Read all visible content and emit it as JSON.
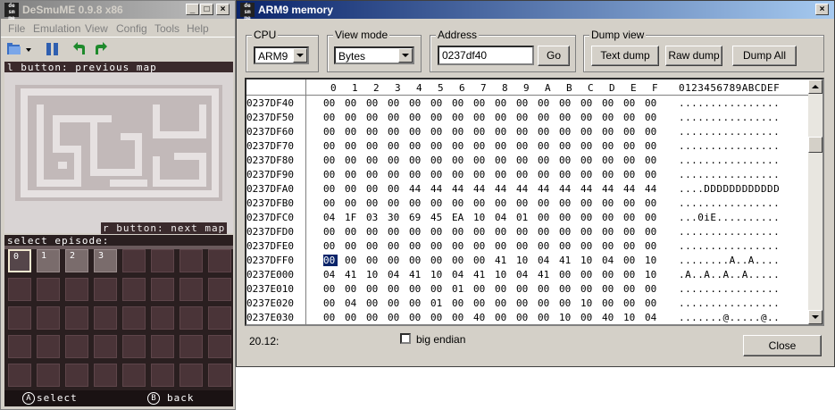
{
  "desmume": {
    "title": "DeSmuME 0.9.8 x86",
    "icon_text": "de sm me",
    "menu": [
      "File",
      "Emulation",
      "View",
      "Config",
      "Tools",
      "Help"
    ],
    "top_screen": {
      "hint_previous": "l button: previous map",
      "hint_next": "r button: next map"
    },
    "bottom_screen": {
      "header": "select episode:",
      "episodes": [
        "0",
        "1",
        "2",
        "3"
      ],
      "footer_select_key": "A",
      "footer_select": "select",
      "footer_back_key": "B",
      "footer_back": "back"
    }
  },
  "memory": {
    "title": "ARM9 memory",
    "icon_text": "de sm me",
    "cpu": {
      "label": "CPU",
      "value": "ARM9"
    },
    "view_mode": {
      "label": "View mode",
      "value": "Bytes"
    },
    "address": {
      "label": "Address",
      "value": "0237df40",
      "go": "Go"
    },
    "dump_view": {
      "label": "Dump view",
      "text_dump": "Text dump",
      "raw_dump": "Raw dump",
      "dump_all": "Dump All"
    },
    "header_cols": [
      "0",
      "1",
      "2",
      "3",
      "4",
      "5",
      "6",
      "7",
      "8",
      "9",
      "A",
      "B",
      "C",
      "D",
      "E",
      "F"
    ],
    "header_ascii": "0123456789ABCDEF",
    "rows": [
      {
        "addr": "0237DF40",
        "bytes": [
          "00",
          "00",
          "00",
          "00",
          "00",
          "00",
          "00",
          "00",
          "00",
          "00",
          "00",
          "00",
          "00",
          "00",
          "00",
          "00"
        ],
        "ascii": "................"
      },
      {
        "addr": "0237DF50",
        "bytes": [
          "00",
          "00",
          "00",
          "00",
          "00",
          "00",
          "00",
          "00",
          "00",
          "00",
          "00",
          "00",
          "00",
          "00",
          "00",
          "00"
        ],
        "ascii": "................"
      },
      {
        "addr": "0237DF60",
        "bytes": [
          "00",
          "00",
          "00",
          "00",
          "00",
          "00",
          "00",
          "00",
          "00",
          "00",
          "00",
          "00",
          "00",
          "00",
          "00",
          "00"
        ],
        "ascii": "................"
      },
      {
        "addr": "0237DF70",
        "bytes": [
          "00",
          "00",
          "00",
          "00",
          "00",
          "00",
          "00",
          "00",
          "00",
          "00",
          "00",
          "00",
          "00",
          "00",
          "00",
          "00"
        ],
        "ascii": "................"
      },
      {
        "addr": "0237DF80",
        "bytes": [
          "00",
          "00",
          "00",
          "00",
          "00",
          "00",
          "00",
          "00",
          "00",
          "00",
          "00",
          "00",
          "00",
          "00",
          "00",
          "00"
        ],
        "ascii": "................"
      },
      {
        "addr": "0237DF90",
        "bytes": [
          "00",
          "00",
          "00",
          "00",
          "00",
          "00",
          "00",
          "00",
          "00",
          "00",
          "00",
          "00",
          "00",
          "00",
          "00",
          "00"
        ],
        "ascii": "................"
      },
      {
        "addr": "0237DFA0",
        "bytes": [
          "00",
          "00",
          "00",
          "00",
          "44",
          "44",
          "44",
          "44",
          "44",
          "44",
          "44",
          "44",
          "44",
          "44",
          "44",
          "44"
        ],
        "ascii": "....DDDDDDDDDDDD"
      },
      {
        "addr": "0237DFB0",
        "bytes": [
          "00",
          "00",
          "00",
          "00",
          "00",
          "00",
          "00",
          "00",
          "00",
          "00",
          "00",
          "00",
          "00",
          "00",
          "00",
          "00"
        ],
        "ascii": "................"
      },
      {
        "addr": "0237DFC0",
        "bytes": [
          "04",
          "1F",
          "03",
          "30",
          "69",
          "45",
          "EA",
          "10",
          "04",
          "01",
          "00",
          "00",
          "00",
          "00",
          "00",
          "00"
        ],
        "ascii": "...0iE.........."
      },
      {
        "addr": "0237DFD0",
        "bytes": [
          "00",
          "00",
          "00",
          "00",
          "00",
          "00",
          "00",
          "00",
          "00",
          "00",
          "00",
          "00",
          "00",
          "00",
          "00",
          "00"
        ],
        "ascii": "................"
      },
      {
        "addr": "0237DFE0",
        "bytes": [
          "00",
          "00",
          "00",
          "00",
          "00",
          "00",
          "00",
          "00",
          "00",
          "00",
          "00",
          "00",
          "00",
          "00",
          "00",
          "00"
        ],
        "ascii": "................"
      },
      {
        "addr": "0237DFF0",
        "bytes": [
          "00",
          "00",
          "00",
          "00",
          "00",
          "00",
          "00",
          "00",
          "41",
          "10",
          "04",
          "41",
          "10",
          "04",
          "00",
          "10"
        ],
        "ascii": "........A..A...."
      },
      {
        "addr": "0237E000",
        "bytes": [
          "04",
          "41",
          "10",
          "04",
          "41",
          "10",
          "04",
          "41",
          "10",
          "04",
          "41",
          "00",
          "00",
          "00",
          "00",
          "10"
        ],
        "ascii": ".A..A..A..A....."
      },
      {
        "addr": "0237E010",
        "bytes": [
          "00",
          "00",
          "00",
          "00",
          "00",
          "00",
          "01",
          "00",
          "00",
          "00",
          "00",
          "00",
          "00",
          "00",
          "00",
          "00"
        ],
        "ascii": "................"
      },
      {
        "addr": "0237E020",
        "bytes": [
          "00",
          "04",
          "00",
          "00",
          "00",
          "01",
          "00",
          "00",
          "00",
          "00",
          "00",
          "00",
          "10",
          "00",
          "00",
          "00"
        ],
        "ascii": "................"
      },
      {
        "addr": "0237E030",
        "bytes": [
          "00",
          "00",
          "00",
          "00",
          "00",
          "00",
          "00",
          "40",
          "00",
          "00",
          "00",
          "10",
          "00",
          "40",
          "10",
          "04"
        ],
        "ascii": ".......@.....@.."
      }
    ],
    "status": "20.12:",
    "big_endian": "big endian",
    "close": "Close"
  }
}
